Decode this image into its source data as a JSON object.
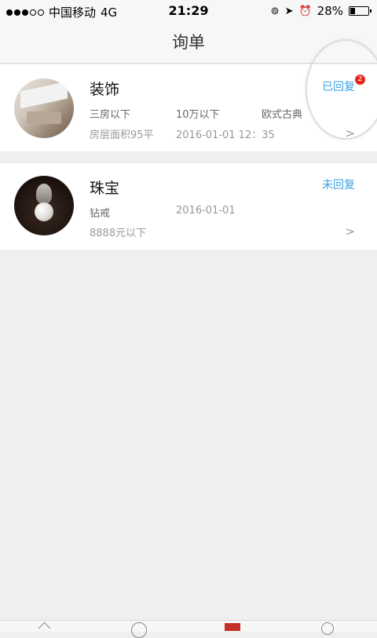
{
  "status_bar": {
    "carrier": "中国移动",
    "network": "4G",
    "time": "21:29",
    "battery": "28%",
    "battery_level": 0.28
  },
  "nav": {
    "title": "询单"
  },
  "inquiries": [
    {
      "category": "装饰",
      "status": "已回复",
      "badge": "2",
      "attr1": "三房以下",
      "attr2": "10万以下",
      "attr3": "欧式古典",
      "area": "房层面积95平",
      "datetime": "2016-01-01 12：35",
      "chevron": ">"
    },
    {
      "category": "珠宝",
      "status": "未回复",
      "attr1": "钻戒",
      "date": "2016-01-01",
      "price": "8888元以下",
      "chevron": ">"
    }
  ],
  "colors": {
    "status_blue": "#3aa2e3",
    "badge_red": "#e4271c",
    "tab_active": "#c6302a"
  },
  "icons": [
    "location-arrow-icon",
    "alarm-icon",
    "orientation-lock-icon",
    "battery-icon",
    "home-icon",
    "compass-icon",
    "calendar-icon",
    "profile-icon"
  ]
}
